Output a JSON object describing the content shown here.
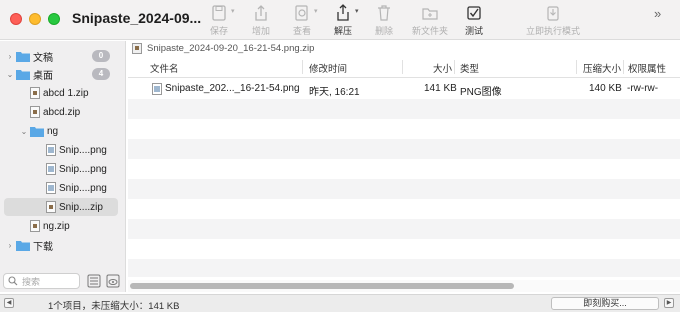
{
  "window": {
    "title": "Snipaste_2024-09..."
  },
  "toolbar": {
    "buttons": [
      {
        "label": "保存",
        "icon": "save-icon",
        "enabled": false
      },
      {
        "label": "增加",
        "icon": "add-icon",
        "enabled": false
      },
      {
        "label": "查看",
        "icon": "view-icon",
        "enabled": false
      },
      {
        "label": "解压",
        "icon": "extract-icon",
        "enabled": true
      },
      {
        "label": "删除",
        "icon": "trash-icon",
        "enabled": false
      },
      {
        "label": "新文件夹",
        "icon": "new-folder-icon",
        "enabled": false
      },
      {
        "label": "测试",
        "icon": "test-icon",
        "enabled": true
      },
      {
        "label": "立即执行模式",
        "icon": "execute-mode-icon",
        "enabled": false
      }
    ],
    "more": "»"
  },
  "sidebar": {
    "items": [
      {
        "label": "文稿",
        "count": "0",
        "type": "folder"
      },
      {
        "label": "桌面",
        "count": "4",
        "type": "folder"
      },
      {
        "label": "abcd 1.zip",
        "type": "zip"
      },
      {
        "label": "abcd.zip",
        "type": "zip"
      },
      {
        "label": "ng",
        "type": "folder"
      },
      {
        "label": "Snip....png",
        "type": "png"
      },
      {
        "label": "Snip....png",
        "type": "png"
      },
      {
        "label": "Snip....png",
        "type": "png"
      },
      {
        "label": "Snip....zip",
        "type": "zip",
        "selected": true
      },
      {
        "label": "ng.zip",
        "type": "zip"
      },
      {
        "label": "下载",
        "type": "folder"
      }
    ],
    "search_placeholder": "搜索"
  },
  "pathbar": {
    "path": "Snipaste_2024-09-20_16-21-54.png.zip"
  },
  "table": {
    "columns": [
      "文件名",
      "修改时间",
      "大小",
      "类型",
      "压缩大小",
      "权限属性"
    ],
    "rows": [
      {
        "name": "Snipaste_202..._16-21-54.png",
        "modified": "昨天, 16:21",
        "size": "141 KB",
        "type": "PNG图像",
        "compressed": "140 KB",
        "permissions": "-rw-rw-"
      }
    ]
  },
  "status": {
    "text": "1个项目，未压缩大小：141 KB",
    "buy_label": "即刻购买..."
  },
  "colors": {
    "red": "#fe5f57",
    "yellow": "#febc2e",
    "green": "#28c840",
    "folder": "#5aa8e6"
  }
}
